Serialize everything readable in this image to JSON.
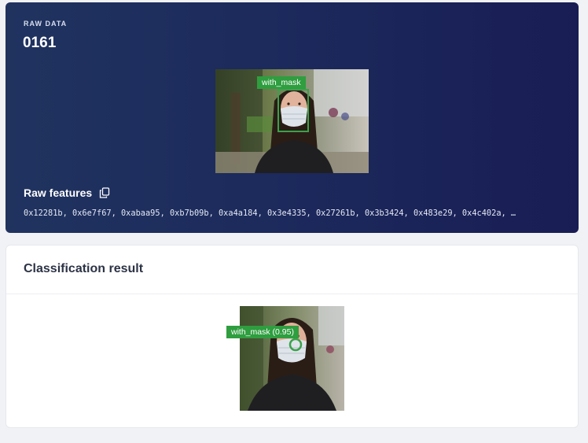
{
  "raw_data": {
    "eyebrow": "RAW DATA",
    "sample_id": "0161",
    "image": {
      "alt": "Woman wearing a surgical face mask on a street",
      "detection_label": "with_mask"
    },
    "features_label": "Raw features",
    "features_values": "0x12281b, 0x6e7f67, 0xabaa95, 0xb7b09b, 0xa4a184, 0x3e4335, 0x27261b, 0x3b3424, 0x483e29, 0x4c402a, …",
    "copy_icon": "copy-icon"
  },
  "classification": {
    "title": "Classification result",
    "image": {
      "alt": "Cropped image of woman wearing a face mask",
      "detection_label": "with_mask (0.95)"
    }
  },
  "colors": {
    "panel_gradient_start": "#20335f",
    "panel_gradient_end": "#191d54",
    "detection_green": "#2e9e3f",
    "page_background": "#f1f2f5"
  }
}
